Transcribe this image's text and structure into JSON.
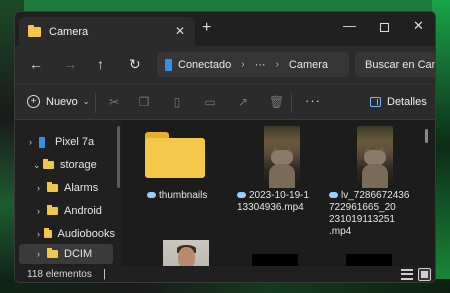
{
  "window": {
    "tab_title": "Camera",
    "tab_close": "✕",
    "new_tab": "+",
    "controls": {
      "minimize": "—",
      "close": "✕"
    }
  },
  "nav": {
    "back": "←",
    "forward": "→",
    "up": "↑",
    "refresh": "↻",
    "breadcrumb": [
      "Conectado",
      "···",
      "Camera"
    ],
    "separator": "›",
    "search_placeholder": "Buscar en Camera"
  },
  "toolbar": {
    "new_label": "Nuevo",
    "new_chevron": "⌄",
    "icons": [
      "cut-icon",
      "copy-icon",
      "paste-icon",
      "rename-icon",
      "share-icon",
      "delete-icon"
    ],
    "more": "···",
    "details_label": "Detalles"
  },
  "sidebar": {
    "items": [
      {
        "label": "Pixel 7a",
        "chevron": "›",
        "icon": "phone-icon"
      },
      {
        "label": "storage",
        "chevron": "⌄",
        "icon": "folder-icon"
      },
      {
        "label": "Alarms",
        "chevron": "›",
        "icon": "folder-icon"
      },
      {
        "label": "Android",
        "chevron": "›",
        "icon": "folder-icon"
      },
      {
        "label": "Audiobooks",
        "chevron": "›",
        "icon": "folder-icon"
      },
      {
        "label": "DCIM",
        "chevron": "›",
        "icon": "folder-icon",
        "selected": true
      }
    ]
  },
  "files": [
    {
      "name": "thumbnails",
      "type": "folder",
      "cloud": true
    },
    {
      "name": "2023-10-19-1\n13304936.mp4",
      "type": "video",
      "cloud": true
    },
    {
      "name": "lv_7286672436\n722961665_20\n231019113251\n.mp4",
      "type": "video",
      "cloud": true
    },
    {
      "name": "",
      "type": "image"
    },
    {
      "name": "",
      "type": "image-black"
    },
    {
      "name": "",
      "type": "image-black"
    }
  ],
  "status": {
    "count": "118 elementos",
    "caret": "|"
  },
  "colors": {
    "window_bg": "#202020",
    "accent": "#3b8ee6",
    "folder": "#f4c84a"
  }
}
